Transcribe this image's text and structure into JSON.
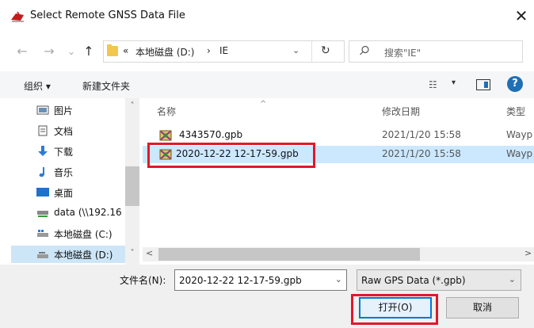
{
  "window": {
    "title": "Select Remote GNSS Data File",
    "close_glyph": "✕"
  },
  "nav": {
    "back_glyph": "←",
    "forward_glyph": "→",
    "recent_glyph": "⌄",
    "up_glyph": "↑",
    "breadcrumb": [
      "«",
      "本地磁盘 (D:)",
      "›",
      "IE"
    ],
    "address_dropdown_glyph": "⌄",
    "refresh_glyph": "↻",
    "search_placeholder": "搜索\"IE\""
  },
  "toolbar": {
    "organize": "组织 ▾",
    "new_folder": "新建文件夹",
    "view_glyph": "☷",
    "view_caret": "▾",
    "help_glyph": "?"
  },
  "sidebar": {
    "items": [
      {
        "label": "图片",
        "icon": "pictures-icon"
      },
      {
        "label": "文档",
        "icon": "documents-icon"
      },
      {
        "label": "下载",
        "icon": "downloads-icon"
      },
      {
        "label": "音乐",
        "icon": "music-icon"
      },
      {
        "label": "桌面",
        "icon": "desktop-icon"
      },
      {
        "label": "data (\\\\192.16",
        "icon": "network-drive-icon"
      },
      {
        "label": "本地磁盘 (C:)",
        "icon": "drive-icon"
      },
      {
        "label": "本地磁盘 (D:)",
        "icon": "drive-icon",
        "selected": true
      }
    ],
    "scroll_up": "˄",
    "scroll_down": "˅"
  },
  "files": {
    "columns": {
      "name": "名称",
      "date": "修改日期",
      "type": "类型",
      "sort_glyph": "^"
    },
    "rows": [
      {
        "name": "4343570.gpb",
        "date": "2021/1/20 15:58",
        "type": "Wayp",
        "selected": false
      },
      {
        "name": "2020-12-22 12-17-59.gpb",
        "date": "2021/1/20 15:58",
        "type": "Wayp",
        "selected": true
      }
    ],
    "hscroll_left": "<",
    "hscroll_right": ">"
  },
  "footer": {
    "filename_label": "文件名(N):",
    "filename_value": "2020-12-22 12-17-59.gpb",
    "filename_dd": "⌄",
    "filetype_value": "Raw GPS Data (*.gpb)",
    "filetype_dd": "⌄",
    "open_button": "打开(O)",
    "cancel_button": "取消"
  },
  "colors": {
    "highlight": "#e0182a",
    "selection": "#cce8ff",
    "accent": "#0078d7"
  }
}
